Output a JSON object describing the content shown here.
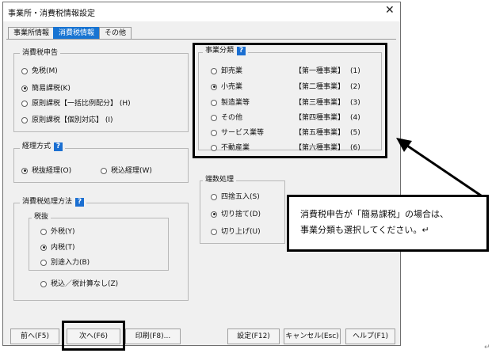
{
  "window": {
    "title": "事業所・消費税情報設定",
    "close_glyph": "✕"
  },
  "tabs": [
    {
      "label": "事業所情報",
      "active": false
    },
    {
      "label": "消費税情報",
      "active": true
    },
    {
      "label": "その他",
      "active": false
    }
  ],
  "tax_return": {
    "legend": "消費税申告",
    "options": [
      {
        "label": "免税(M)",
        "selected": false
      },
      {
        "label": "簡易課税(K)",
        "selected": true
      },
      {
        "label": "原則課税【一括比例配分】 (H)",
        "selected": false
      },
      {
        "label": "原則課税【個別対応】 (I)",
        "selected": false
      }
    ]
  },
  "business_category": {
    "legend": "事業分類",
    "help_glyph": "?",
    "options": [
      {
        "label": "卸売業",
        "kind": "【第一種事業】",
        "num": "(1)",
        "selected": false
      },
      {
        "label": "小売業",
        "kind": "【第二種事業】",
        "num": "(2)",
        "selected": true
      },
      {
        "label": "製造業等",
        "kind": "【第三種事業】",
        "num": "(3)",
        "selected": false
      },
      {
        "label": "その他",
        "kind": "【第四種事業】",
        "num": "(4)",
        "selected": false
      },
      {
        "label": "サービス業等",
        "kind": "【第五種事業】",
        "num": "(5)",
        "selected": false
      },
      {
        "label": "不動産業",
        "kind": "【第六種事業】",
        "num": "(6)",
        "selected": false
      }
    ]
  },
  "accounting": {
    "legend": "経理方式",
    "help_glyph": "?",
    "options": [
      {
        "label": "税抜経理(O)",
        "selected": true
      },
      {
        "label": "税込経理(W)",
        "selected": false
      }
    ]
  },
  "rounding": {
    "legend": "端数処理",
    "options": [
      {
        "label": "四捨五入(S)",
        "selected": false
      },
      {
        "label": "切り捨て(D)",
        "selected": true
      },
      {
        "label": "切り上げ(U)",
        "selected": false
      }
    ]
  },
  "tax_method": {
    "legend": "消費税処理方法",
    "help_glyph": "?",
    "sub_legend": "税抜",
    "sub_options": [
      {
        "label": "外税(Y)",
        "selected": false
      },
      {
        "label": "内税(T)",
        "selected": true
      },
      {
        "label": "別途入力(B)",
        "selected": false
      }
    ],
    "extra_option": {
      "label": "税込／税計算なし(Z)",
      "selected": false
    }
  },
  "buttons": {
    "prev": "前へ(F5)",
    "next": "次へ(F6)",
    "print": "印刷(F8)...",
    "settings": "設定(F12)",
    "cancel": "キャンセル(Esc)",
    "help": "ヘルプ(F1)"
  },
  "callout": {
    "line1": "消費税申告が「簡易課税」の場合は、",
    "line2": "事業分類も選択してください。↵"
  },
  "corner_mark": "↵"
}
